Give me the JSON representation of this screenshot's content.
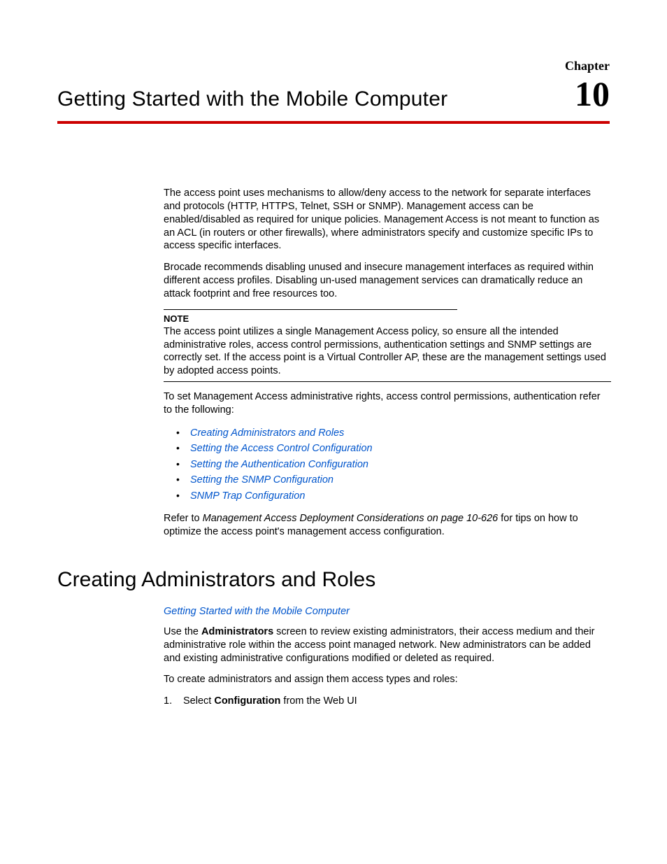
{
  "chapter": {
    "label": "Chapter",
    "number": "10",
    "title": "Getting Started with the Mobile Computer"
  },
  "paragraphs": {
    "p1": "The access point uses mechanisms to allow/deny access to the network for separate interfaces and protocols (HTTP, HTTPS, Telnet, SSH or SNMP). Management access can be enabled/disabled as required for unique policies. Management Access is not meant to function as an ACL (in routers or other firewalls), where administrators specify and customize specific IPs to access specific interfaces.",
    "p2": "Brocade recommends disabling unused and insecure management interfaces as required within different access profiles. Disabling un-used management services can dramatically reduce an attack footprint and free resources too.",
    "noteLabel": "NOTE",
    "noteText": "The access point utilizes a single Management Access policy, so ensure all the intended administrative roles, access control permissions, authentication settings and SNMP settings are correctly set. If the access point is a Virtual Controller AP, these are the management settings used by adopted access points.",
    "p3": "To set Management Access administrative rights, access control permissions, authentication refer to the following:",
    "bullets": {
      "b1": "Creating Administrators and Roles",
      "b2": "Setting the Access Control Configuration",
      "b3": "Setting the Authentication Configuration",
      "b4": "Setting the SNMP Configuration",
      "b5": "SNMP Trap Configuration"
    },
    "p4a": "Refer to ",
    "p4b": "Management Access Deployment Considerations on page 10-626",
    "p4c": " for tips on how to optimize the access point's management access configuration."
  },
  "section": {
    "heading": "Creating Administrators and Roles",
    "parentLink": "Getting Started with the Mobile Computer",
    "p1a": "Use the ",
    "p1b": "Administrators",
    "p1c": " screen to review existing administrators, their access medium and their administrative role within the access point managed network. New administrators can be added and existing administrative configurations modified or deleted as required.",
    "p2": "To create administrators and assign them access types and roles:",
    "step1a": "Select ",
    "step1b": "Configuration",
    "step1c": " from the Web UI"
  }
}
